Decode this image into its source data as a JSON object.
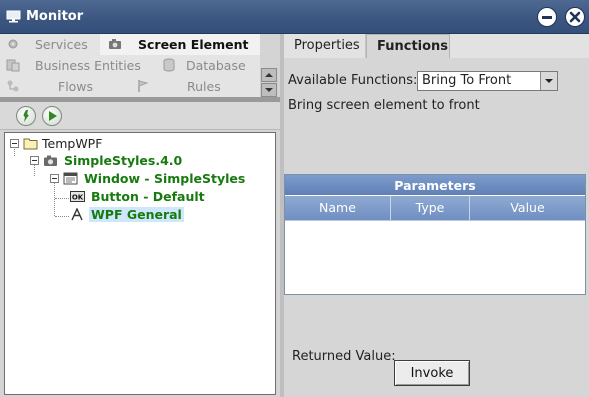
{
  "window": {
    "title": "Monitor",
    "app_icon": "monitor-icon",
    "minimize_icon": "minimize-icon",
    "close_icon": "close-icon"
  },
  "nav": {
    "items": [
      {
        "label": "Services",
        "icon": "gear-icon",
        "active": false
      },
      {
        "label": "Screen Element",
        "icon": "camera-icon",
        "active": true
      },
      {
        "label": "Business Entities",
        "icon": "entities-icon",
        "active": false
      },
      {
        "label": "Database",
        "icon": "database-icon",
        "active": false
      },
      {
        "label": "Flows",
        "icon": "flows-icon",
        "active": false
      },
      {
        "label": "Rules",
        "icon": "flag-icon",
        "active": false
      }
    ]
  },
  "toolbar": {
    "capture_icon": "capture-icon",
    "run_icon": "play-icon"
  },
  "tree": {
    "nodes": [
      {
        "label": "TempWPF",
        "icon": "folder-icon"
      },
      {
        "label": "SimpleStyles.4.0",
        "icon": "camera-icon"
      },
      {
        "label": "Window - SimpleStyles",
        "icon": "window-icon"
      },
      {
        "label": "Button - Default",
        "icon": "ok-button-icon"
      },
      {
        "label": "WPF General",
        "icon": "text-icon",
        "selected": true
      }
    ]
  },
  "tabs": [
    {
      "label": "Properties",
      "active": false
    },
    {
      "label": "Functions",
      "active": true
    }
  ],
  "functions": {
    "available_label": "Available Functions:",
    "selected_function": "Bring To Front",
    "description": "Bring screen element to front",
    "parameters": {
      "title": "Parameters",
      "columns": [
        "Name",
        "Type",
        "Value"
      ],
      "rows": []
    },
    "returned_label": "Returned Value:",
    "invoke_label": "Invoke"
  },
  "colors": {
    "titlebar": "#3c5680",
    "tree_green": "#177a0f",
    "selection": "#cfe7fb",
    "grid_header": "#6f8fc2"
  }
}
